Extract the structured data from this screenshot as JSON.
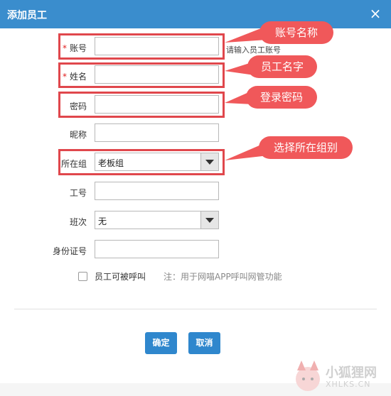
{
  "dialog": {
    "title": "添加员工",
    "close_symbol": "×"
  },
  "fields": {
    "account": {
      "label": "账号",
      "required_mark": "*",
      "value": "",
      "hint": "请输入员工账号"
    },
    "name": {
      "label": "姓名",
      "required_mark": "*",
      "value": ""
    },
    "password": {
      "label": "密码",
      "value": ""
    },
    "nickname": {
      "label": "昵称",
      "value": ""
    },
    "group": {
      "label": "所在组",
      "selected": "老板组"
    },
    "employee_no": {
      "label": "工号",
      "value": ""
    },
    "shift": {
      "label": "班次",
      "selected": "无"
    },
    "id_no": {
      "label": "身份证号",
      "value": ""
    }
  },
  "callable": {
    "label": "员工可被呼叫",
    "checked": false,
    "note": "注：用于网喵APP呼叫网管功能"
  },
  "annotations": {
    "account": "账号名称",
    "name": "员工名字",
    "password": "登录密码",
    "group": "选择所在组别"
  },
  "buttons": {
    "confirm": "确定",
    "cancel": "取消"
  },
  "watermark": {
    "text": "小狐狸网",
    "sub": "XHLKS.CN"
  },
  "colors": {
    "titlebar": "#3a8dcd",
    "highlight": "#e0474c",
    "bubble": "#f0585a",
    "button": "#2f87cd"
  }
}
